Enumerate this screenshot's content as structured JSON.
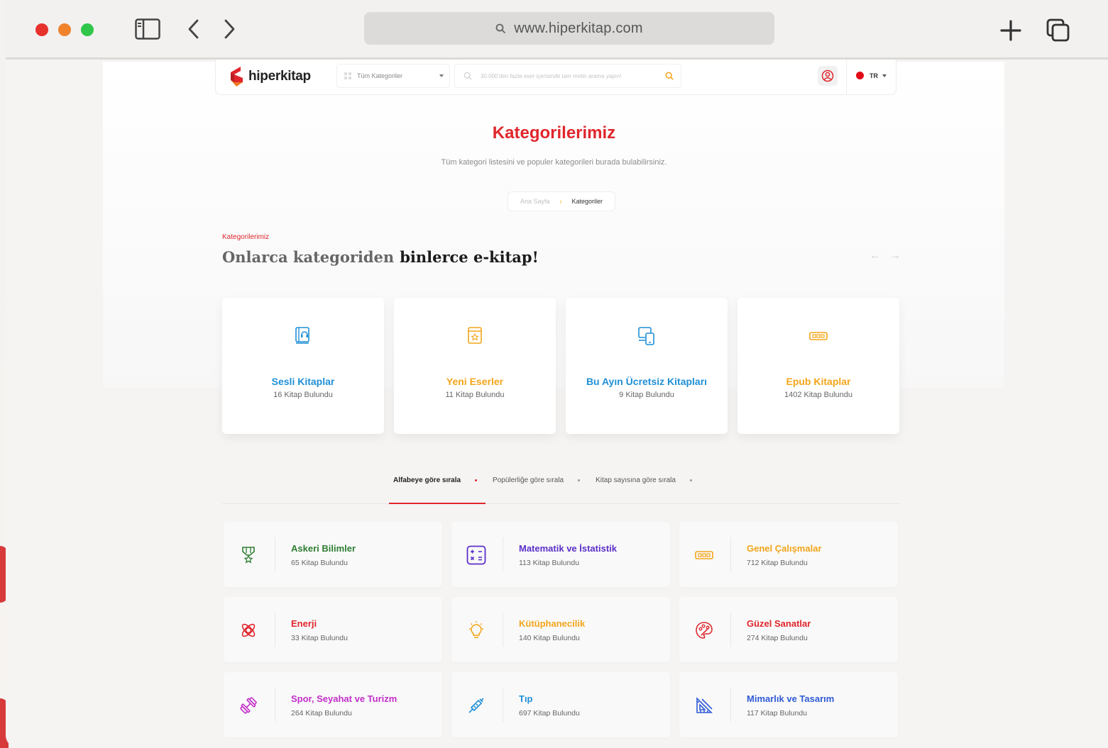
{
  "browser": {
    "url": "www.hiperkitap.com"
  },
  "header": {
    "logo_text": "hiperkitap",
    "category_select": "Tüm Kategoriler",
    "search_placeholder": "30.000'den fazla eser içerisinde tam metin arama yapın!",
    "lang": "TR"
  },
  "hero": {
    "title": "Kategorilerimiz",
    "subtitle": "Tüm kategori listesini ve populer kategorileri burada bulabilirsiniz.",
    "breadcrumb_home": "Ana Sayfa",
    "breadcrumb_current": "Kategoriler"
  },
  "section": {
    "label": "Kategorilerimiz",
    "title_part1": "Onlarca kategoriden",
    "title_part2": "binlerce e-kitap!"
  },
  "featured": [
    {
      "title": "Sesli Kitaplar",
      "count": "16 Kitap Bulundu",
      "color": "#1f8fd6",
      "icon": "audiobook-icon"
    },
    {
      "title": "Yeni Eserler",
      "count": "11 Kitap Bulundu",
      "color": "#f2a51a",
      "icon": "new-book-icon"
    },
    {
      "title": "Bu Ayın Ücretsiz Kitapları",
      "count": "9 Kitap Bulundu",
      "color": "#1f8fd6",
      "icon": "devices-icon"
    },
    {
      "title": "Epub Kitaplar",
      "count": "1402 Kitap Bulundu",
      "color": "#f2a51a",
      "icon": "epub-icon"
    }
  ],
  "sort": {
    "alpha": "Alfabeye göre sırala",
    "popular": "Popülerliğe göre sırala",
    "count": "Kitap sayısına göre sırala"
  },
  "categories": [
    {
      "title": "Askeri Bilimler",
      "count": "65 Kitap Bulundu",
      "color": "#2e7d32",
      "icon": "medal-icon"
    },
    {
      "title": "Matematik ve İstatistik",
      "count": "113 Kitap Bulundu",
      "color": "#5b2fc9",
      "icon": "calculator-icon"
    },
    {
      "title": "Genel Çalışmalar",
      "count": "712 Kitap Bulundu",
      "color": "#f2a51a",
      "icon": "epub-icon"
    },
    {
      "title": "Enerji",
      "count": "33 Kitap Bulundu",
      "color": "#e0262c",
      "icon": "atom-icon"
    },
    {
      "title": "Kütüphanecilik",
      "count": "140 Kitap Bulundu",
      "color": "#f2a51a",
      "icon": "lightbulb-icon"
    },
    {
      "title": "Güzel Sanatlar",
      "count": "274 Kitap Bulundu",
      "color": "#e0262c",
      "icon": "palette-icon"
    },
    {
      "title": "Spor, Seyahat ve Turizm",
      "count": "264 Kitap Bulundu",
      "color": "#c22ec9",
      "icon": "dumbbell-icon"
    },
    {
      "title": "Tıp",
      "count": "697 Kitap Bulundu",
      "color": "#1f8fd6",
      "icon": "syringe-icon"
    },
    {
      "title": "Mimarlık ve Tasarım",
      "count": "117 Kitap Bulundu",
      "color": "#2f5bd6",
      "icon": "ruler-icon"
    }
  ]
}
